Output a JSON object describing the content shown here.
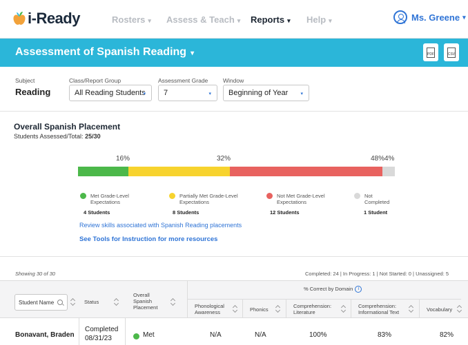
{
  "nav": {
    "logo": "i-Ready",
    "items": [
      {
        "label": "Rosters",
        "caret": "▾"
      },
      {
        "label": "Assess & Teach",
        "caret": "▾"
      },
      {
        "label": "Reports",
        "caret": "▾"
      },
      {
        "label": "Help",
        "caret": "▾"
      }
    ],
    "user": "Ms. Greene",
    "user_caret": "▾"
  },
  "titlebar": {
    "title": "Assessment of Spanish Reading",
    "caret": "▾",
    "pdf_label": "PDF",
    "csv_label": "CSV"
  },
  "filters": {
    "subject_label": "Subject",
    "subject_value": "Reading",
    "group_label": "Class/Report Group",
    "group_value": "All Reading Students",
    "grade_label": "Assessment Grade",
    "grade_value": "7",
    "window_label": "Window",
    "window_value": "Beginning of Year",
    "caret": "▾"
  },
  "placement": {
    "heading": "Overall Spanish Placement",
    "assessed_label": "Students Assessed/Total:",
    "assessed_value": "25/30",
    "segments": [
      {
        "pct": "16%",
        "value": 16,
        "color": "#4cb84a"
      },
      {
        "pct": "32%",
        "value": 32,
        "color": "#f7d32e"
      },
      {
        "pct": "48%",
        "value": 48,
        "color": "#e8625f"
      },
      {
        "pct": "4%",
        "value": 4,
        "color": "#d9d9d9"
      }
    ],
    "legend": [
      {
        "label": "Met Grade-Level Expectations",
        "count": "4 Students",
        "color": "#4cb84a"
      },
      {
        "label": "Partially Met Grade-Level Expectations",
        "count": "8 Students",
        "color": "#f7d32e"
      },
      {
        "label": "Not Met Grade-Level Expectations",
        "count": "12 Students",
        "color": "#e8625f"
      },
      {
        "label": "Not Completed",
        "count": "1 Student",
        "color": "#d9d9d9"
      }
    ],
    "link_review": "Review skills associated with Spanish Reading placements",
    "link_tools": "See Tools for Instruction for more resources"
  },
  "table": {
    "showing": "Showing 30 of 30",
    "stats": "Completed: 24 | In Progress: 1 | Not Started: 0 | Unassigned: 5",
    "search_placeholder": "Student Name",
    "status_header": "Status",
    "placement_header": "Overall Spanish Placement",
    "domain_header": "% Correct by Domain",
    "domains": [
      "Phonological Awareness",
      "Phonics",
      "Comprehension: Literature",
      "Comprehension: Informational Text",
      "Vocabulary"
    ],
    "rows": [
      {
        "name": "Bonavant, Braden",
        "status": "Completed",
        "date": "08/31/23",
        "placement": "Met",
        "scores": [
          "N/A",
          "N/A",
          "100%",
          "83%",
          "82%"
        ]
      }
    ]
  }
}
